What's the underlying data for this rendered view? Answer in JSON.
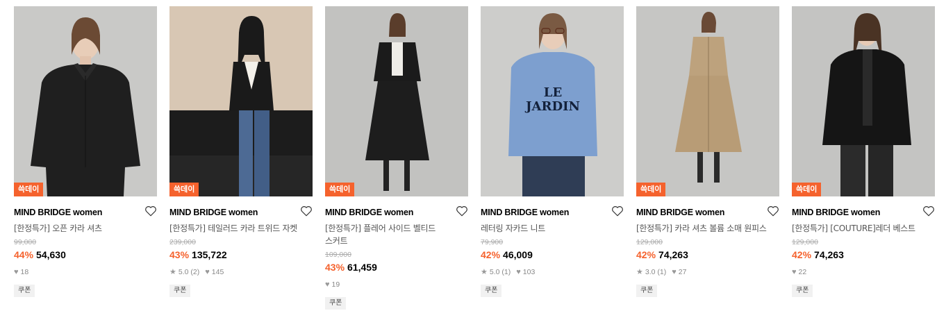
{
  "products": [
    {
      "badge": "쓱데이",
      "brand": "MIND BRIDGE women",
      "name_line1": "[한정특가] 오픈 카라 셔츠",
      "name_line2": "",
      "original_price": "99,000",
      "discount": "44%",
      "price": "54,630",
      "rating": "",
      "review_count": "",
      "likes": "18",
      "coupon": "쿠폰",
      "bg": "#c9c9c7",
      "outfit": "#1f1f1f"
    },
    {
      "badge": "쓱데이",
      "brand": "MIND BRIDGE women",
      "name_line1": "[한정특가] 테일러드 카라 트위드 자켓",
      "name_line2": "",
      "original_price": "239,000",
      "discount": "43%",
      "price": "135,722",
      "rating": "5.0",
      "review_count": "(2)",
      "likes": "145",
      "coupon": "쿠폰",
      "bg": "#d8c7b4",
      "outfit": "#1a1a1a"
    },
    {
      "badge": "쓱데이",
      "brand": "MIND BRIDGE women",
      "name_line1": "[한정특가] 플레어 사이드 벨티드",
      "name_line2": "스커트",
      "original_price": "109,000",
      "discount": "43%",
      "price": "61,459",
      "rating": "",
      "review_count": "",
      "likes": "19",
      "coupon": "쿠폰",
      "bg": "#c2c2c0",
      "outfit": "#1b1b1b"
    },
    {
      "badge": "",
      "brand": "MIND BRIDGE women",
      "name_line1": "레터링 자카드 니트",
      "name_line2": "",
      "original_price": "79,900",
      "discount": "42%",
      "price": "46,009",
      "rating": "5.0",
      "review_count": "(1)",
      "likes": "103",
      "coupon": "쿠폰",
      "bg": "#cdcdcb",
      "outfit": "#7d9fcf"
    },
    {
      "badge": "쓱데이",
      "brand": "MIND BRIDGE women",
      "name_line1": "[한정특가] 카라 셔츠 볼륨 소매 원피스",
      "name_line2": "",
      "original_price": "129,000",
      "discount": "42%",
      "price": "74,263",
      "rating": "3.0",
      "review_count": "(1)",
      "likes": "27",
      "coupon": "쿠폰",
      "bg": "#c6c6c4",
      "outfit": "#bda27d"
    },
    {
      "badge": "쓱데이",
      "brand": "MIND BRIDGE women",
      "name_line1": "[한정특가] [COUTURE]레더 베스트",
      "name_line2": "",
      "original_price": "129,000",
      "discount": "42%",
      "price": "74,263",
      "rating": "",
      "review_count": "",
      "likes": "22",
      "coupon": "쿠폰",
      "bg": "#c4c4c2",
      "outfit": "#151515"
    }
  ],
  "icons": {
    "heart": "heart-outline-icon",
    "star": "star-icon",
    "like": "heart-filled-icon"
  },
  "colors": {
    "accent": "#f5622d"
  }
}
